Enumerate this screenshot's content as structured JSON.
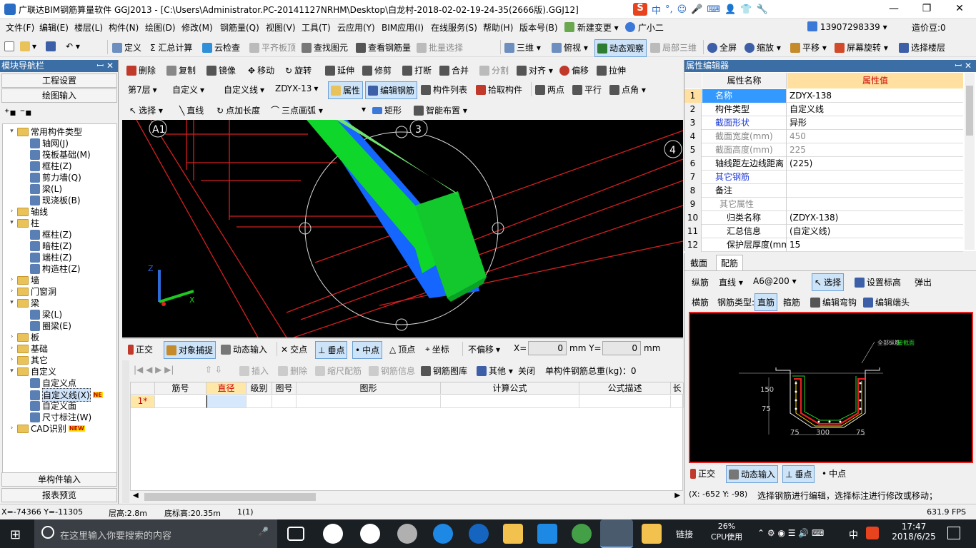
{
  "window": {
    "title": "广联达BIM钢筋算量软件 GGJ2013 - [C:\\Users\\Administrator.PC-20141127NRHM\\Desktop\\白龙村-2018-02-02-19-24-35(2666版).GGJ12]",
    "minimize": "—",
    "maximize": "❐",
    "close": "✕"
  },
  "ime": {
    "logo": "S",
    "items": [
      "中",
      "°,",
      "☺",
      "🎤",
      "⌨",
      "👤",
      "👕",
      "🔧"
    ]
  },
  "menu": [
    "文件(F)",
    "编辑(E)",
    "楼层(L)",
    "构件(N)",
    "绘图(D)",
    "修改(M)",
    "钢筋量(Q)",
    "视图(V)",
    "工具(T)",
    "云应用(Y)",
    "BIM应用(I)",
    "在线服务(S)",
    "帮助(H)",
    "版本号(B)",
    "新建变更 ▾",
    "广小二"
  ],
  "account": {
    "phone": "13907298339 ▾",
    "price": "造价豆:0"
  },
  "toolbar1": [
    "定义",
    "Σ 汇总计算",
    "云检查",
    "平齐板顶",
    "查找图元",
    "查看钢筋量",
    "批量选择",
    "三维 ▾",
    "俯视 ▾",
    "动态观察",
    "局部三维",
    "全屏",
    "缩放 ▾",
    "平移 ▾",
    "屏幕旋转 ▾",
    "选择楼层"
  ],
  "toolbar2": [
    "删除",
    "复制",
    "镜像",
    "移动",
    "旋转",
    "延伸",
    "修剪",
    "打断",
    "合并",
    "分割",
    "对齐 ▾",
    "偏移",
    "拉伸"
  ],
  "toolbar3": {
    "floor": "第7层",
    "cat": "自定义",
    "type": "自定义线",
    "name": "ZDYX-13",
    "items": [
      "属性",
      "编辑钢筋",
      "构件列表",
      "拾取构件",
      "两点",
      "平行",
      "点角 ▾"
    ]
  },
  "toolbar4": [
    "选择 ▾",
    "直线",
    "点加长度",
    "三点画弧 ▾",
    "矩形",
    "智能布置 ▾"
  ],
  "nav": {
    "title": "模块导航栏",
    "pin": "ꟷ ✕",
    "btn1": "工程设置",
    "btn2": "绘图输入",
    "btn3": "单构件输入",
    "btn4": "报表预览",
    "tree": [
      {
        "t": "常用构件类型",
        "lv": 0,
        "exp": "−",
        "f": true
      },
      {
        "t": "轴网(J)",
        "lv": 2
      },
      {
        "t": "筏板基础(M)",
        "lv": 2
      },
      {
        "t": "框柱(Z)",
        "lv": 2
      },
      {
        "t": "剪力墙(Q)",
        "lv": 2
      },
      {
        "t": "梁(L)",
        "lv": 2
      },
      {
        "t": "现浇板(B)",
        "lv": 2
      },
      {
        "t": "轴线",
        "lv": 0,
        "exp": "+",
        "f": true
      },
      {
        "t": "柱",
        "lv": 0,
        "exp": "−",
        "f": true
      },
      {
        "t": "框柱(Z)",
        "lv": 2
      },
      {
        "t": "暗柱(Z)",
        "lv": 2
      },
      {
        "t": "端柱(Z)",
        "lv": 2
      },
      {
        "t": "构造柱(Z)",
        "lv": 2
      },
      {
        "t": "墙",
        "lv": 0,
        "exp": "+",
        "f": true
      },
      {
        "t": "门窗洞",
        "lv": 0,
        "exp": "+",
        "f": true
      },
      {
        "t": "梁",
        "lv": 0,
        "exp": "−",
        "f": true
      },
      {
        "t": "梁(L)",
        "lv": 2
      },
      {
        "t": "圈梁(E)",
        "lv": 2
      },
      {
        "t": "板",
        "lv": 0,
        "exp": "+",
        "f": true
      },
      {
        "t": "基础",
        "lv": 0,
        "exp": "+",
        "f": true
      },
      {
        "t": "其它",
        "lv": 0,
        "exp": "+",
        "f": true
      },
      {
        "t": "自定义",
        "lv": 0,
        "exp": "−",
        "f": true
      },
      {
        "t": "自定义点",
        "lv": 2
      },
      {
        "t": "自定义线(X)",
        "lv": 2,
        "sel": true,
        "badge": "NE"
      },
      {
        "t": "自定义面",
        "lv": 2
      },
      {
        "t": "尺寸标注(W)",
        "lv": 2
      },
      {
        "t": "CAD识别",
        "lv": 0,
        "exp": "+",
        "f": true,
        "badge": "NEW"
      }
    ]
  },
  "cad": {
    "labels": [
      "A1",
      "3",
      "4"
    ],
    "axis": {
      "z": "Z",
      "x": "X"
    }
  },
  "snap": {
    "items": [
      "正交",
      "对象捕捉",
      "动态输入",
      "交点",
      "垂点",
      "中点",
      "顶点",
      "坐标"
    ],
    "offset": "不偏移",
    "x_label": "X=",
    "x_val": "0",
    "y_label": "mm Y=",
    "y_val": "0",
    "unit": "mm"
  },
  "rebar": {
    "items": [
      "插入",
      "删除",
      "缩尺配筋",
      "钢筋信息",
      "钢筋图库",
      "其他 ▾",
      "关闭"
    ],
    "total": "单构件钢筋总重(kg)：0"
  },
  "grid": {
    "cols": [
      "筋号",
      "直径(mm)",
      "级别",
      "图号",
      "图形",
      "计算公式",
      "公式描述",
      "长"
    ],
    "row1": "1*"
  },
  "props": {
    "title": "属性编辑器",
    "h_name": "属性名称",
    "h_val": "属性值",
    "rows": [
      {
        "n": "1",
        "k": "名称",
        "v": "ZDYX-138",
        "blue": false,
        "sel": true
      },
      {
        "n": "2",
        "k": "构件类型",
        "v": "自定义线"
      },
      {
        "n": "3",
        "k": "截面形状",
        "v": "异形",
        "blue": true
      },
      {
        "n": "4",
        "k": "截面宽度(mm)",
        "v": "450",
        "gray": true
      },
      {
        "n": "5",
        "k": "截面高度(mm)",
        "v": "225",
        "gray": true
      },
      {
        "n": "6",
        "k": "轴线距左边线距离",
        "v": "(225)"
      },
      {
        "n": "7",
        "k": "其它钢筋",
        "v": "",
        "blue": true
      },
      {
        "n": "8",
        "k": "备注",
        "v": ""
      },
      {
        "n": "9",
        "k": "其它属性",
        "v": "",
        "gray": true,
        "grp": true
      },
      {
        "n": "10",
        "k": "归类名称",
        "v": "(ZDYX-138)",
        "sub": true
      },
      {
        "n": "11",
        "k": "汇总信息",
        "v": "(自定义线)",
        "sub": true
      },
      {
        "n": "12",
        "k": "保护层厚度(mm)",
        "v": "15",
        "sub": true
      }
    ]
  },
  "lower": {
    "tabs": [
      "截面",
      "配筋"
    ],
    "row1": [
      "纵筋",
      "直线 ▾",
      "A6@200 ▾",
      "选择",
      "设置标高",
      "弹出"
    ],
    "row2": [
      "横筋",
      "钢筋类型:",
      "直筋",
      "箍筋",
      "编辑弯钩",
      "编辑端头"
    ],
    "preview": {
      "t1": "全部纵筋",
      "t2": "接截面",
      "d1": "150",
      "d2": "75",
      "d3": "300",
      "d4": "75",
      "d5": "75"
    },
    "bottom": [
      "正交",
      "动态输入",
      "垂点",
      "中点"
    ],
    "coord": "(X: -652 Y: -98)",
    "hint": "选择钢筋进行编辑，选择标注进行修改或移动；"
  },
  "status": {
    "xy": "X=-74366 Y=-11305",
    "floor_h": "层高:2.8m",
    "base_h": "底标高:20.35m",
    "count": "1(1)",
    "fps": "631.9 FPS"
  },
  "taskbar": {
    "search": "在这里输入你要搜索的内容",
    "link": "链接",
    "cpu": "26%",
    "cpu_label": "CPU使用",
    "lang": "中",
    "time": "17:47",
    "date": "2018/6/25"
  }
}
